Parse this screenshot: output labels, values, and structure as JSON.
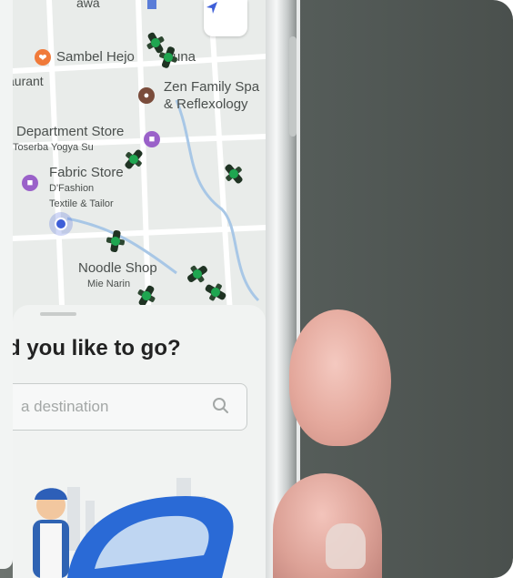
{
  "map": {
    "street_top": "awa",
    "pois": [
      {
        "label": "Sambel Hejo",
        "suffix": "una",
        "icon": "restaurant-icon"
      },
      {
        "label": "aurant",
        "icon": ""
      },
      {
        "label": "Zen Family Spa",
        "line2": "& Reflexology",
        "icon": "spa-icon"
      },
      {
        "label": "Department Store",
        "line2": "Toserba Yogya Su",
        "icon": "shopping-bag-icon"
      },
      {
        "label": "Fabric Store",
        "line2": "D'Fashion",
        "line3": "Textile & Tailor",
        "icon": "shopping-bag-icon"
      },
      {
        "label": "Noodle Shop",
        "line2": "Mie Narin",
        "icon": ""
      }
    ],
    "nav_icon": "navigation-arrow-icon",
    "driver_icon": "motorbike-driver-icon"
  },
  "sheet": {
    "title": "d you like to go?",
    "search_placeholder": "a destination",
    "search_icon": "search-icon",
    "illustration": "driver-with-car-illustration"
  },
  "colors": {
    "accent": "#3e5fd8",
    "driver_green": "#1fa650",
    "background": "#5b625f"
  }
}
